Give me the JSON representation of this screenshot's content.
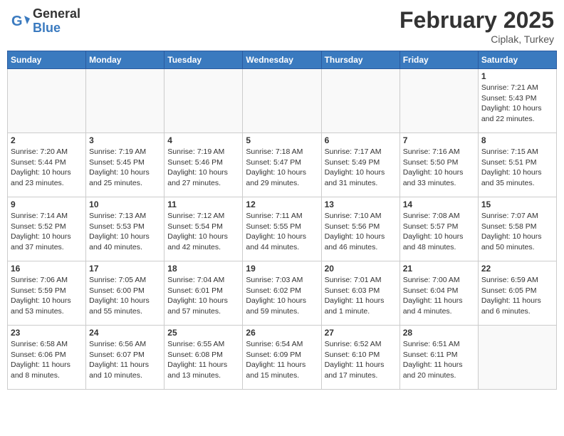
{
  "header": {
    "logo_general": "General",
    "logo_blue": "Blue",
    "month_title": "February 2025",
    "location": "Ciplak, Turkey"
  },
  "days_of_week": [
    "Sunday",
    "Monday",
    "Tuesday",
    "Wednesday",
    "Thursday",
    "Friday",
    "Saturday"
  ],
  "weeks": [
    [
      {
        "day": "",
        "info": ""
      },
      {
        "day": "",
        "info": ""
      },
      {
        "day": "",
        "info": ""
      },
      {
        "day": "",
        "info": ""
      },
      {
        "day": "",
        "info": ""
      },
      {
        "day": "",
        "info": ""
      },
      {
        "day": "1",
        "info": "Sunrise: 7:21 AM\nSunset: 5:43 PM\nDaylight: 10 hours and 22 minutes."
      }
    ],
    [
      {
        "day": "2",
        "info": "Sunrise: 7:20 AM\nSunset: 5:44 PM\nDaylight: 10 hours and 23 minutes."
      },
      {
        "day": "3",
        "info": "Sunrise: 7:19 AM\nSunset: 5:45 PM\nDaylight: 10 hours and 25 minutes."
      },
      {
        "day": "4",
        "info": "Sunrise: 7:19 AM\nSunset: 5:46 PM\nDaylight: 10 hours and 27 minutes."
      },
      {
        "day": "5",
        "info": "Sunrise: 7:18 AM\nSunset: 5:47 PM\nDaylight: 10 hours and 29 minutes."
      },
      {
        "day": "6",
        "info": "Sunrise: 7:17 AM\nSunset: 5:49 PM\nDaylight: 10 hours and 31 minutes."
      },
      {
        "day": "7",
        "info": "Sunrise: 7:16 AM\nSunset: 5:50 PM\nDaylight: 10 hours and 33 minutes."
      },
      {
        "day": "8",
        "info": "Sunrise: 7:15 AM\nSunset: 5:51 PM\nDaylight: 10 hours and 35 minutes."
      }
    ],
    [
      {
        "day": "9",
        "info": "Sunrise: 7:14 AM\nSunset: 5:52 PM\nDaylight: 10 hours and 37 minutes."
      },
      {
        "day": "10",
        "info": "Sunrise: 7:13 AM\nSunset: 5:53 PM\nDaylight: 10 hours and 40 minutes."
      },
      {
        "day": "11",
        "info": "Sunrise: 7:12 AM\nSunset: 5:54 PM\nDaylight: 10 hours and 42 minutes."
      },
      {
        "day": "12",
        "info": "Sunrise: 7:11 AM\nSunset: 5:55 PM\nDaylight: 10 hours and 44 minutes."
      },
      {
        "day": "13",
        "info": "Sunrise: 7:10 AM\nSunset: 5:56 PM\nDaylight: 10 hours and 46 minutes."
      },
      {
        "day": "14",
        "info": "Sunrise: 7:08 AM\nSunset: 5:57 PM\nDaylight: 10 hours and 48 minutes."
      },
      {
        "day": "15",
        "info": "Sunrise: 7:07 AM\nSunset: 5:58 PM\nDaylight: 10 hours and 50 minutes."
      }
    ],
    [
      {
        "day": "16",
        "info": "Sunrise: 7:06 AM\nSunset: 5:59 PM\nDaylight: 10 hours and 53 minutes."
      },
      {
        "day": "17",
        "info": "Sunrise: 7:05 AM\nSunset: 6:00 PM\nDaylight: 10 hours and 55 minutes."
      },
      {
        "day": "18",
        "info": "Sunrise: 7:04 AM\nSunset: 6:01 PM\nDaylight: 10 hours and 57 minutes."
      },
      {
        "day": "19",
        "info": "Sunrise: 7:03 AM\nSunset: 6:02 PM\nDaylight: 10 hours and 59 minutes."
      },
      {
        "day": "20",
        "info": "Sunrise: 7:01 AM\nSunset: 6:03 PM\nDaylight: 11 hours and 1 minute."
      },
      {
        "day": "21",
        "info": "Sunrise: 7:00 AM\nSunset: 6:04 PM\nDaylight: 11 hours and 4 minutes."
      },
      {
        "day": "22",
        "info": "Sunrise: 6:59 AM\nSunset: 6:05 PM\nDaylight: 11 hours and 6 minutes."
      }
    ],
    [
      {
        "day": "23",
        "info": "Sunrise: 6:58 AM\nSunset: 6:06 PM\nDaylight: 11 hours and 8 minutes."
      },
      {
        "day": "24",
        "info": "Sunrise: 6:56 AM\nSunset: 6:07 PM\nDaylight: 11 hours and 10 minutes."
      },
      {
        "day": "25",
        "info": "Sunrise: 6:55 AM\nSunset: 6:08 PM\nDaylight: 11 hours and 13 minutes."
      },
      {
        "day": "26",
        "info": "Sunrise: 6:54 AM\nSunset: 6:09 PM\nDaylight: 11 hours and 15 minutes."
      },
      {
        "day": "27",
        "info": "Sunrise: 6:52 AM\nSunset: 6:10 PM\nDaylight: 11 hours and 17 minutes."
      },
      {
        "day": "28",
        "info": "Sunrise: 6:51 AM\nSunset: 6:11 PM\nDaylight: 11 hours and 20 minutes."
      },
      {
        "day": "",
        "info": ""
      }
    ]
  ]
}
